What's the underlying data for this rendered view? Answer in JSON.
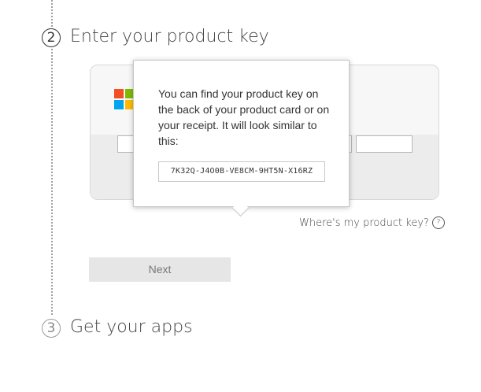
{
  "steps": {
    "step2": {
      "number": "2",
      "title": "Enter your product key"
    },
    "step3": {
      "number": "3",
      "title": "Get your apps"
    }
  },
  "tooltip": {
    "text": "You can find your product key on the back of your product card or on your receipt. It will look similar to this:",
    "sample_key": "7K32Q-J4O0B-VE8CM-9HT5N-X16RZ"
  },
  "help_link": {
    "label": "Where's my product key?",
    "icon": "question-circle-icon",
    "glyph": "?"
  },
  "next_button": {
    "label": "Next"
  },
  "colors": {
    "logo_red": "#f25022",
    "logo_green": "#7fba00",
    "logo_blue": "#00a4ef",
    "logo_yellow": "#ffb900"
  }
}
